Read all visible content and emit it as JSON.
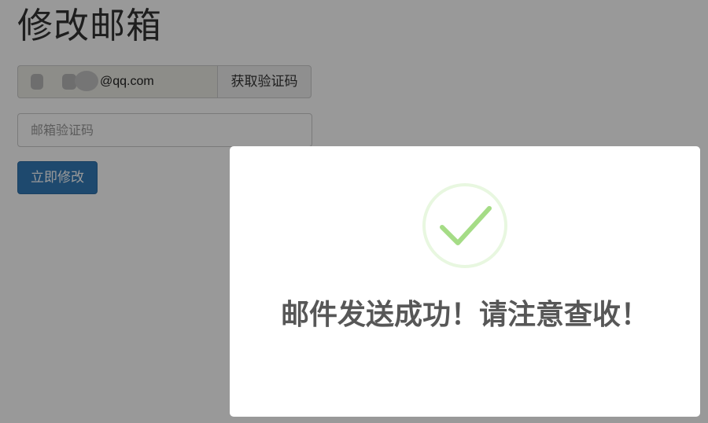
{
  "page": {
    "title": "修改邮箱"
  },
  "form": {
    "email_value": "@qq.com",
    "get_code_label": "获取验证码",
    "code_placeholder": "邮箱验证码",
    "submit_label": "立即修改"
  },
  "modal": {
    "icon": "checkmark-icon",
    "message": "邮件发送成功！请注意查收！"
  },
  "colors": {
    "primary": "#337ab7",
    "success_check": "#a5dc86",
    "success_ring": "#e8f7e0",
    "overlay": "rgba(0,0,0,0.4)"
  }
}
